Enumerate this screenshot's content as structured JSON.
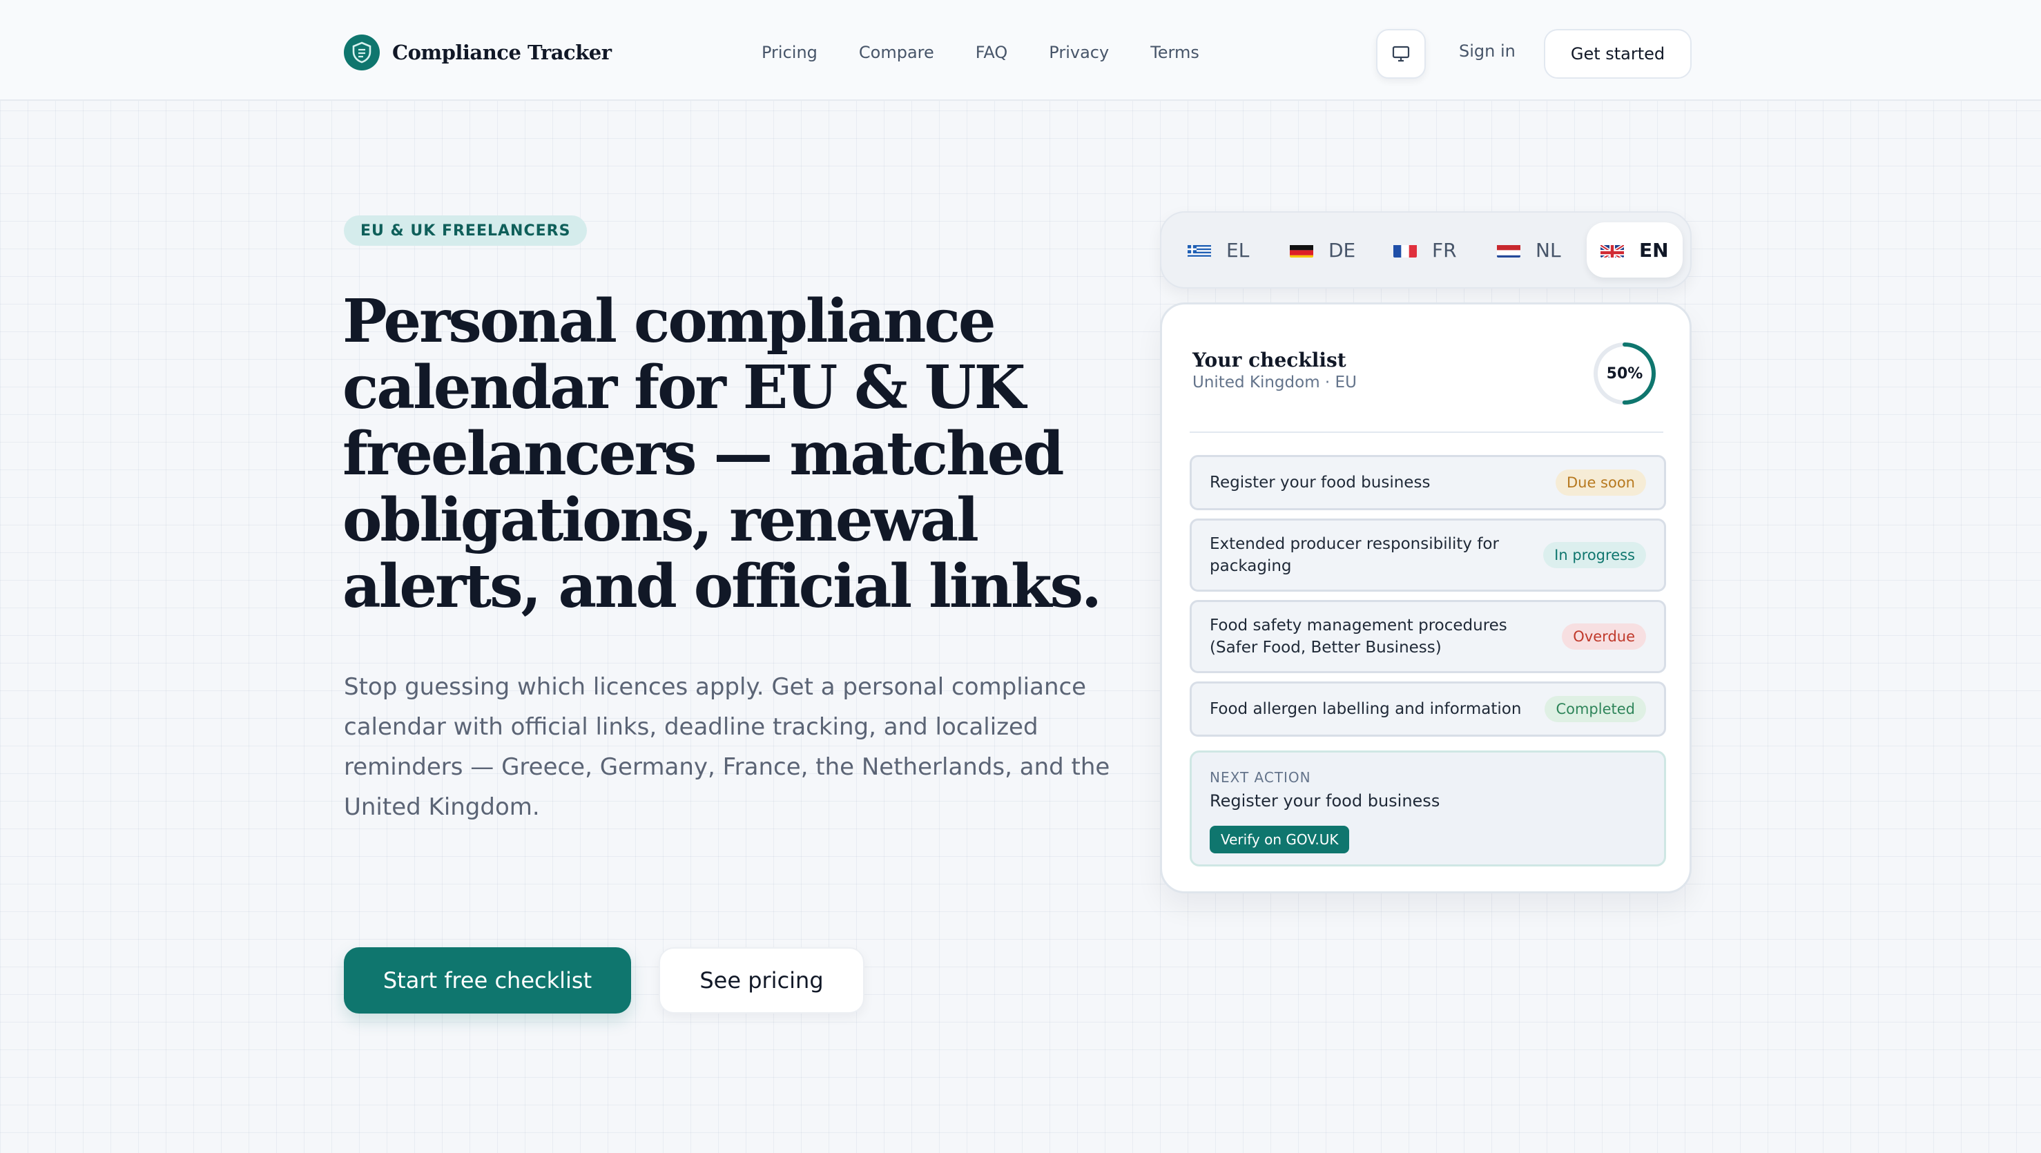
{
  "header": {
    "brand": "Compliance Tracker",
    "nav": [
      "Pricing",
      "Compare",
      "FAQ",
      "Privacy",
      "Terms"
    ],
    "theme_icon": "monitor-icon",
    "signin_label": "Sign in",
    "get_started_label": "Get started"
  },
  "hero": {
    "eyebrow": "EU & UK FREELANCERS",
    "headline": "Personal compliance calendar for EU & UK freelancers — matched obligations, renewal alerts, and official links.",
    "subcopy": "Stop guessing which licences apply. Get a personal compliance calendar with official links, deadline tracking, and localized reminders — Greece, Germany, France, the Netherlands, and the United Kingdom.",
    "cta_primary": "Start free checklist",
    "cta_secondary": "See pricing"
  },
  "languages": [
    {
      "code": "EL",
      "flag": "greece-flag-icon",
      "active": false
    },
    {
      "code": "DE",
      "flag": "germany-flag-icon",
      "active": false
    },
    {
      "code": "FR",
      "flag": "france-flag-icon",
      "active": false
    },
    {
      "code": "NL",
      "flag": "netherlands-flag-icon",
      "active": false
    },
    {
      "code": "EN",
      "flag": "uk-flag-icon",
      "active": true
    }
  ],
  "checklist": {
    "title": "Your checklist",
    "subtitle": "United Kingdom · EU",
    "progress_percent": 50,
    "progress_label": "50%",
    "items": [
      {
        "text": "Register your food business",
        "status": "Due soon"
      },
      {
        "text": "Extended producer responsibility for packaging",
        "status": "In progress"
      },
      {
        "text": "Food safety management procedures (Safer Food, Better Business)",
        "status": "Overdue"
      },
      {
        "text": "Food allergen labelling and information",
        "status": "Completed"
      }
    ],
    "next_action": {
      "label": "NEXT ACTION",
      "task": "Register your food business",
      "button": "Verify on GOV.UK"
    }
  },
  "colors": {
    "brand": "#0f766e",
    "due_soon": "#b7791f",
    "in_progress": "#0f766e",
    "overdue": "#c0392b",
    "completed": "#2f855a"
  }
}
